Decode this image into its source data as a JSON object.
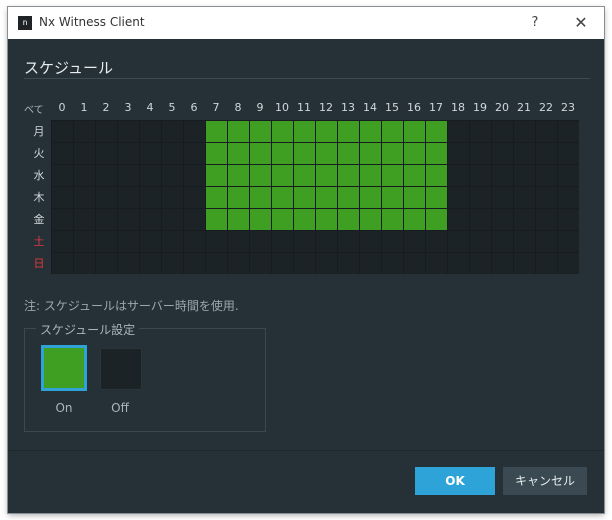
{
  "window": {
    "title": "Nx Witness Client",
    "help_label": "?",
    "close_label": "✕",
    "logo_text": "n"
  },
  "section": {
    "title": "スケジュール"
  },
  "schedule": {
    "corner_label": "べて",
    "hours": [
      "0",
      "1",
      "2",
      "3",
      "4",
      "5",
      "6",
      "7",
      "8",
      "9",
      "10",
      "11",
      "12",
      "13",
      "14",
      "15",
      "16",
      "17",
      "18",
      "19",
      "20",
      "21",
      "22",
      "23"
    ],
    "days": [
      {
        "label": "月",
        "weekend": false
      },
      {
        "label": "火",
        "weekend": false
      },
      {
        "label": "水",
        "weekend": false
      },
      {
        "label": "木",
        "weekend": false
      },
      {
        "label": "金",
        "weekend": false
      },
      {
        "label": "土",
        "weekend": true
      },
      {
        "label": "日",
        "weekend": true
      }
    ],
    "on_color": "#3e9f22",
    "off_color": "#1c2326",
    "weekend_color": "#e0393e",
    "recording": [
      [
        0,
        0,
        0,
        0,
        0,
        0,
        0,
        1,
        1,
        1,
        1,
        1,
        1,
        1,
        1,
        1,
        1,
        1,
        0,
        0,
        0,
        0,
        0,
        0
      ],
      [
        0,
        0,
        0,
        0,
        0,
        0,
        0,
        1,
        1,
        1,
        1,
        1,
        1,
        1,
        1,
        1,
        1,
        1,
        0,
        0,
        0,
        0,
        0,
        0
      ],
      [
        0,
        0,
        0,
        0,
        0,
        0,
        0,
        1,
        1,
        1,
        1,
        1,
        1,
        1,
        1,
        1,
        1,
        1,
        0,
        0,
        0,
        0,
        0,
        0
      ],
      [
        0,
        0,
        0,
        0,
        0,
        0,
        0,
        1,
        1,
        1,
        1,
        1,
        1,
        1,
        1,
        1,
        1,
        1,
        0,
        0,
        0,
        0,
        0,
        0
      ],
      [
        0,
        0,
        0,
        0,
        0,
        0,
        0,
        1,
        1,
        1,
        1,
        1,
        1,
        1,
        1,
        1,
        1,
        1,
        0,
        0,
        0,
        0,
        0,
        0
      ],
      [
        0,
        0,
        0,
        0,
        0,
        0,
        0,
        0,
        0,
        0,
        0,
        0,
        0,
        0,
        0,
        0,
        0,
        0,
        0,
        0,
        0,
        0,
        0,
        0
      ],
      [
        0,
        0,
        0,
        0,
        0,
        0,
        0,
        0,
        0,
        0,
        0,
        0,
        0,
        0,
        0,
        0,
        0,
        0,
        0,
        0,
        0,
        0,
        0,
        0
      ]
    ]
  },
  "note": "注: スケジュールはサーバー時間を使用.",
  "settings": {
    "legend": "スケジュール設定",
    "on_label": "On",
    "off_label": "Off",
    "selected": "On",
    "selected_border_color": "#2fa2d6"
  },
  "buttons": {
    "ok": "OK",
    "cancel": "キャンセル"
  }
}
